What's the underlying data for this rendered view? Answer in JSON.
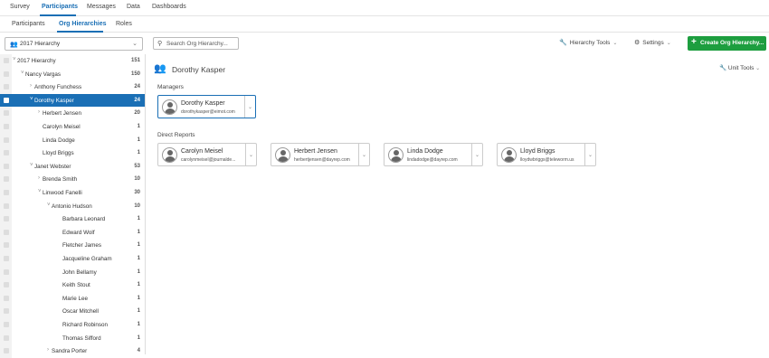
{
  "topnav": {
    "tabs": [
      "Survey",
      "Participants",
      "Messages",
      "Data",
      "Dashboards"
    ],
    "active": "Participants"
  },
  "subnav": {
    "tabs": [
      "Participants",
      "Org Hierarchies",
      "Roles"
    ],
    "active": "Org Hierarchies"
  },
  "hierarchy_select": {
    "value": "2017 Hierarchy"
  },
  "search": {
    "placeholder": "Search Org Hierarchy..."
  },
  "toolbar": {
    "hierarchy_tools": "Hierarchy Tools",
    "settings": "Settings",
    "create": "Create Org Hierarchy..."
  },
  "tree": {
    "rows": [
      {
        "label": "2017 Hierarchy",
        "count": "151",
        "depth": 0,
        "expanded": true
      },
      {
        "label": "Nancy Vargas",
        "count": "150",
        "depth": 1,
        "expanded": true
      },
      {
        "label": "Anthony Funchess",
        "count": "24",
        "depth": 2,
        "expanded": false
      },
      {
        "label": "Dorothy Kasper",
        "count": "24",
        "depth": 2,
        "expanded": true,
        "selected": true
      },
      {
        "label": "Herbert Jensen",
        "count": "20",
        "depth": 3,
        "expanded": false
      },
      {
        "label": "Carolyn Meisel",
        "count": "1",
        "depth": 3,
        "leaf": true
      },
      {
        "label": "Linda Dodge",
        "count": "1",
        "depth": 3,
        "leaf": true
      },
      {
        "label": "Lloyd Briggs",
        "count": "1",
        "depth": 3,
        "leaf": true
      },
      {
        "label": "Janet Webster",
        "count": "53",
        "depth": 2,
        "expanded": true
      },
      {
        "label": "Brenda Smith",
        "count": "10",
        "depth": 3,
        "expanded": false
      },
      {
        "label": "Linwood Fanelli",
        "count": "30",
        "depth": 3,
        "expanded": true
      },
      {
        "label": "Antonio Hudson",
        "count": "10",
        "depth": 4,
        "expanded": true
      },
      {
        "label": "Barbara Leonard",
        "count": "1",
        "depth": 5,
        "leaf": true
      },
      {
        "label": "Edward Wolf",
        "count": "1",
        "depth": 5,
        "leaf": true
      },
      {
        "label": "Fletcher James",
        "count": "1",
        "depth": 5,
        "leaf": true
      },
      {
        "label": "Jacqueline Graham",
        "count": "1",
        "depth": 5,
        "leaf": true
      },
      {
        "label": "John Bellamy",
        "count": "1",
        "depth": 5,
        "leaf": true
      },
      {
        "label": "Keith Stout",
        "count": "1",
        "depth": 5,
        "leaf": true
      },
      {
        "label": "Marie Lee",
        "count": "1",
        "depth": 5,
        "leaf": true
      },
      {
        "label": "Oscar Mitchell",
        "count": "1",
        "depth": 5,
        "leaf": true
      },
      {
        "label": "Richard Robinson",
        "count": "1",
        "depth": 5,
        "leaf": true
      },
      {
        "label": "Thomas Sifford",
        "count": "1",
        "depth": 5,
        "leaf": true
      },
      {
        "label": "Sandra Porter",
        "count": "4",
        "depth": 4,
        "expanded": false
      }
    ]
  },
  "main": {
    "title": "Dorothy Kasper",
    "unit_tools": "Unit Tools",
    "managers_label": "Managers",
    "direct_reports_label": "Direct Reports",
    "manager": {
      "name": "Dorothy Kasper",
      "email": "dorothykasper@eimot.com"
    },
    "reports": [
      {
        "name": "Carolyn Meisel",
        "email": "carolynmeisel@journalde..."
      },
      {
        "name": "Herbert Jensen",
        "email": "herbertjensen@dayrep.com"
      },
      {
        "name": "Linda Dodge",
        "email": "lindadodge@dayrep.com"
      },
      {
        "name": "Lloyd Briggs",
        "email": "lloydwbriggs@teleworm.us"
      }
    ]
  },
  "colors": {
    "accent": "#1a6fb5",
    "create": "#1d9e3f"
  }
}
